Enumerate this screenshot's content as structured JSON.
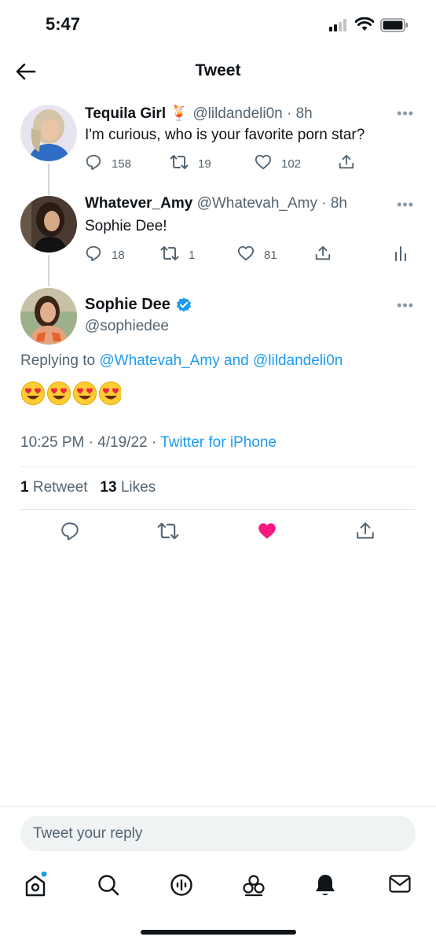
{
  "status_bar": {
    "time": "5:47"
  },
  "header": {
    "title": "Tweet"
  },
  "thread": [
    {
      "name": "Tequila Girl",
      "name_emoji": "🍹",
      "handle": "@lildandeli0n",
      "age": "· 8h",
      "text": "I'm curious, who is your favorite porn star?",
      "replies": "158",
      "retweets": "19",
      "likes": "102"
    },
    {
      "name": "Whatever_Amy",
      "handle": "@Whatevah_Amy",
      "age": "· 8h",
      "text": "Sophie Dee!",
      "replies": "18",
      "retweets": "1",
      "likes": "81"
    }
  ],
  "main_tweet": {
    "name": "Sophie Dee",
    "verified": true,
    "handle": "@sophiedee",
    "replying_prefix": "Replying to ",
    "replying_user1": "@Whatevah_Amy",
    "replying_and": " and ",
    "replying_user2": "@lildandeli0n",
    "emojis": [
      "😍",
      "😍",
      "😍",
      "😍"
    ],
    "time": "10:25 PM",
    "date": "· 4/19/22 ·",
    "source": "Twitter for iPhone",
    "retweet_count": "1",
    "retweet_label": "Retweet",
    "like_count": "13",
    "like_label": "Likes",
    "liked": true
  },
  "reply_bar": {
    "placeholder": "Tweet your reply"
  },
  "tabbar": {
    "items": [
      "home-icon",
      "search-icon",
      "spaces-icon",
      "communities-icon",
      "notifications-icon",
      "messages-icon"
    ]
  },
  "colors": {
    "accent": "#1d9bf0",
    "like": "#f91880",
    "text": "#0f1419",
    "secondary": "#536471"
  }
}
